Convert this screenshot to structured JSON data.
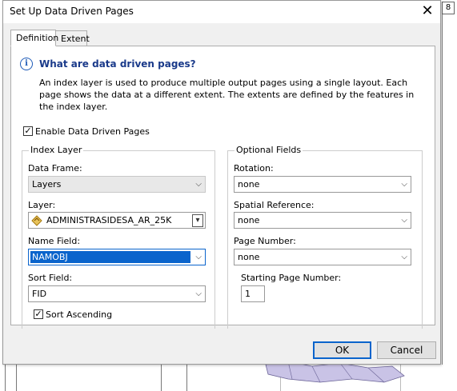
{
  "background": {
    "ruler_mark": "8"
  },
  "dialog": {
    "title": "Set Up Data Driven Pages",
    "close_glyph": "✕",
    "tabs": [
      {
        "label": "Definition",
        "active": true
      },
      {
        "label": "Extent",
        "active": false
      }
    ],
    "info": {
      "icon": "info-icon",
      "heading": "What are data driven pages?",
      "description": "An index layer is used to produce multiple output pages using a single layout.  Each page shows the data at a different extent.  The extents are defined by the features in the index layer."
    },
    "enable_checkbox": {
      "label": "Enable Data Driven Pages",
      "checked": true
    },
    "index_layer": {
      "title": "Index Layer",
      "data_frame": {
        "label": "Data Frame:",
        "value": "Layers"
      },
      "layer": {
        "label": "Layer:",
        "value": "ADMINISTRASIDESA_AR_25K",
        "icon": "polygon-layer-icon"
      },
      "name_field": {
        "label": "Name Field:",
        "value": "NAMOBJ"
      },
      "sort_field": {
        "label": "Sort Field:",
        "value": "FID"
      },
      "sort_ascending": {
        "label": "Sort Ascending",
        "checked": true
      }
    },
    "optional_fields": {
      "title": "Optional Fields",
      "rotation": {
        "label": "Rotation:",
        "value": "none"
      },
      "spatial_reference": {
        "label": "Spatial Reference:",
        "value": "none"
      },
      "page_number": {
        "label": "Page Number:",
        "value": "none"
      },
      "starting_page_number": {
        "label": "Starting Page Number:",
        "value": "1"
      }
    },
    "buttons": {
      "ok": "OK",
      "cancel": "Cancel"
    },
    "colors": {
      "accent": "#0a64cc",
      "heading": "#1a3a8a",
      "info_icon": "#1e5bb8"
    }
  }
}
